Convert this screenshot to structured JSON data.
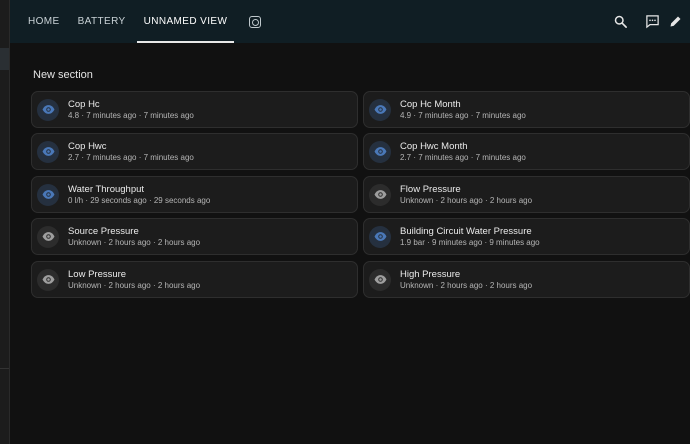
{
  "tabs": [
    {
      "label": "HOME"
    },
    {
      "label": "BATTERY"
    },
    {
      "label": "UNNAMED VIEW"
    }
  ],
  "section": {
    "title": "New section"
  },
  "cards": [
    {
      "name": "Cop Hc",
      "sub": "4.8 · 7 minutes ago · 7 minutes ago",
      "state": "on",
      "icon": "eye-icon"
    },
    {
      "name": "Cop Hc Month",
      "sub": "4.9 · 7 minutes ago · 7 minutes ago",
      "state": "on",
      "icon": "eye-icon"
    },
    {
      "name": "Cop Hwc",
      "sub": "2.7 · 7 minutes ago · 7 minutes ago",
      "state": "on",
      "icon": "eye-icon"
    },
    {
      "name": "Cop Hwc Month",
      "sub": "2.7 · 7 minutes ago · 7 minutes ago",
      "state": "on",
      "icon": "eye-icon"
    },
    {
      "name": "Water Throughput",
      "sub": "0 l/h · 29 seconds ago · 29 seconds ago",
      "state": "on",
      "icon": "eye-icon"
    },
    {
      "name": "Flow Pressure",
      "sub": "Unknown · 2 hours ago · 2 hours ago",
      "state": "off",
      "icon": "eye-icon"
    },
    {
      "name": "Source Pressure",
      "sub": "Unknown · 2 hours ago · 2 hours ago",
      "state": "off",
      "icon": "eye-icon"
    },
    {
      "name": "Building Circuit Water Pressure",
      "sub": "1.9 bar · 9 minutes ago · 9 minutes ago",
      "state": "on",
      "icon": "eye-icon"
    },
    {
      "name": "Low Pressure",
      "sub": "Unknown · 2 hours ago · 2 hours ago",
      "state": "off",
      "icon": "eye-icon"
    },
    {
      "name": "High Pressure",
      "sub": "Unknown · 2 hours ago · 2 hours ago",
      "state": "off",
      "icon": "eye-icon"
    }
  ],
  "colors": {
    "eye_on": "#4a78b8",
    "eye_off": "#9e9e9e",
    "header_bg": "#101e24",
    "card_bg": "#1c1c1c"
  }
}
